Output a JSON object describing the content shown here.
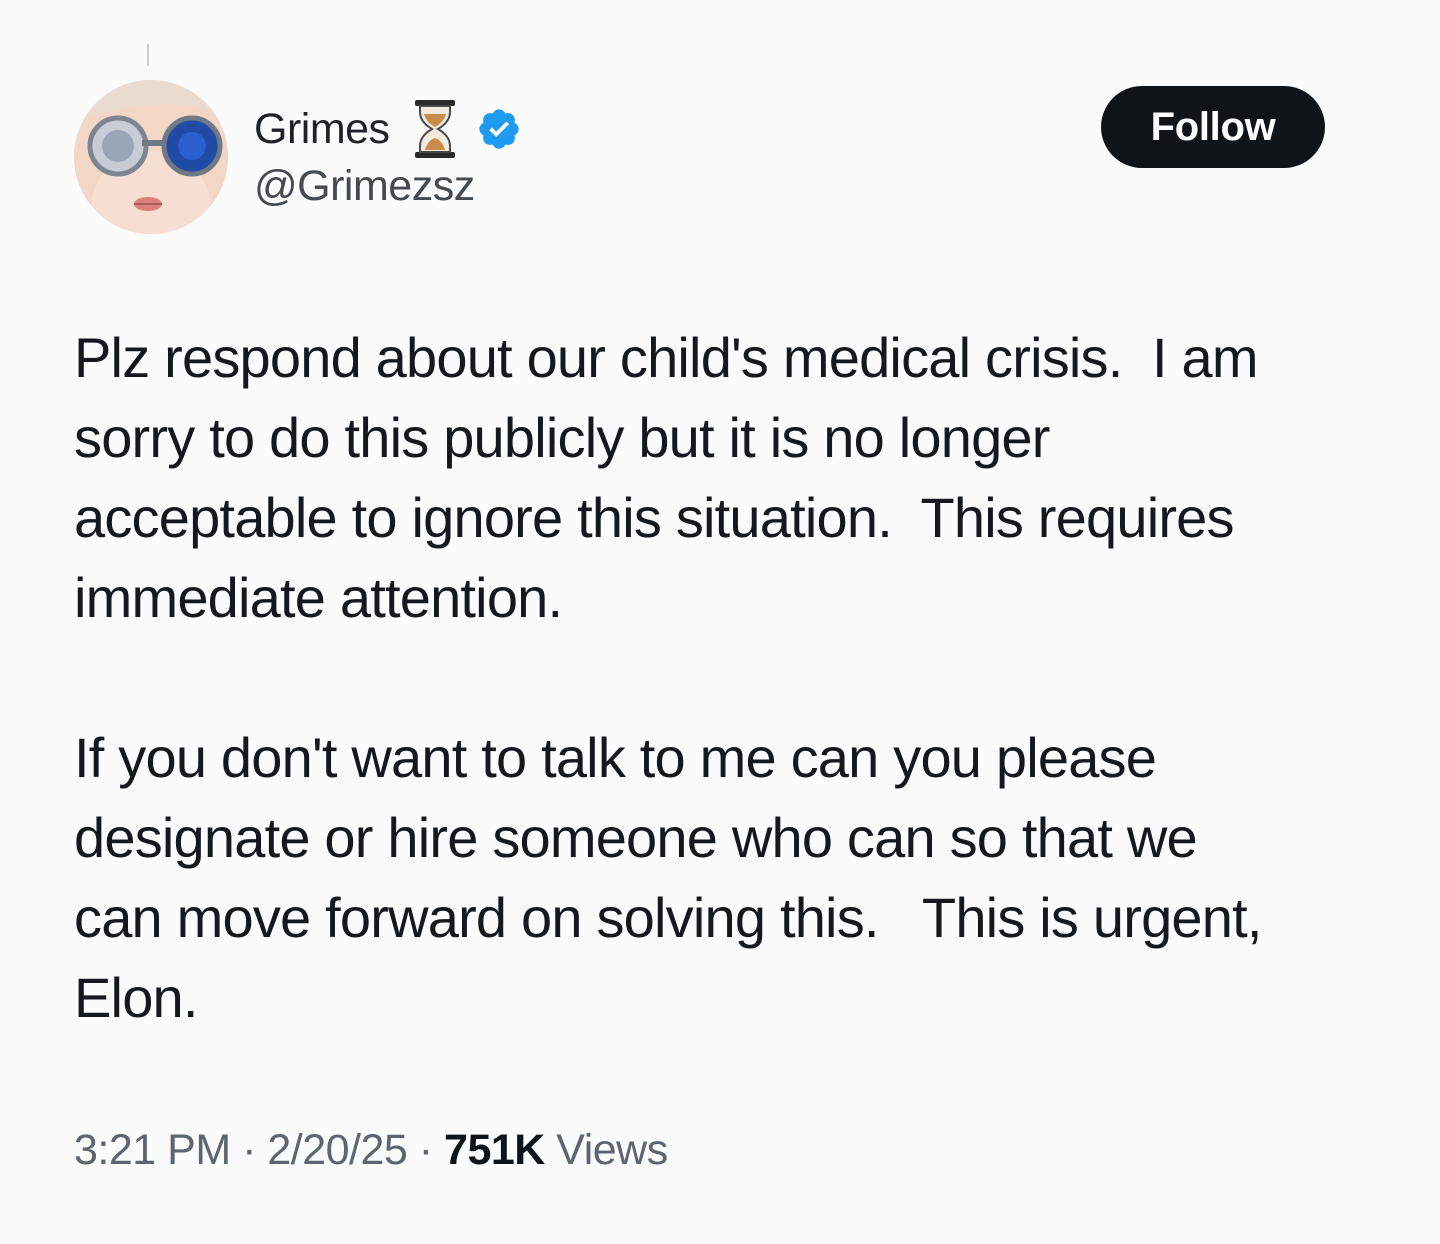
{
  "author": {
    "display_name": "Grimes",
    "handle": "@Grimezsz",
    "emoji_icon": "hourglass-icon",
    "verified_icon": "verified-badge-icon"
  },
  "actions": {
    "follow_label": "Follow"
  },
  "tweet": {
    "paragraph1_lines": [
      "Plz respond about our child's medical crisis.  I am",
      "sorry to do this publicly but it is no longer",
      "acceptable to ignore this situation.  This requires",
      "immediate attention."
    ],
    "paragraph2_lines": [
      "If you don't want to talk to me can you please",
      "designate or hire someone who can so that we",
      "can move forward on solving this.   This is urgent,",
      "Elon."
    ]
  },
  "meta": {
    "time": "3:21 PM",
    "separator": " · ",
    "date": "2/20/25",
    "views_count": "751K",
    "views_label": " Views"
  },
  "colors": {
    "background": "#fbfbfc",
    "verified_blue": "#1d9bf0",
    "button_bg": "#0f1419",
    "muted_text": "#5c6570"
  }
}
